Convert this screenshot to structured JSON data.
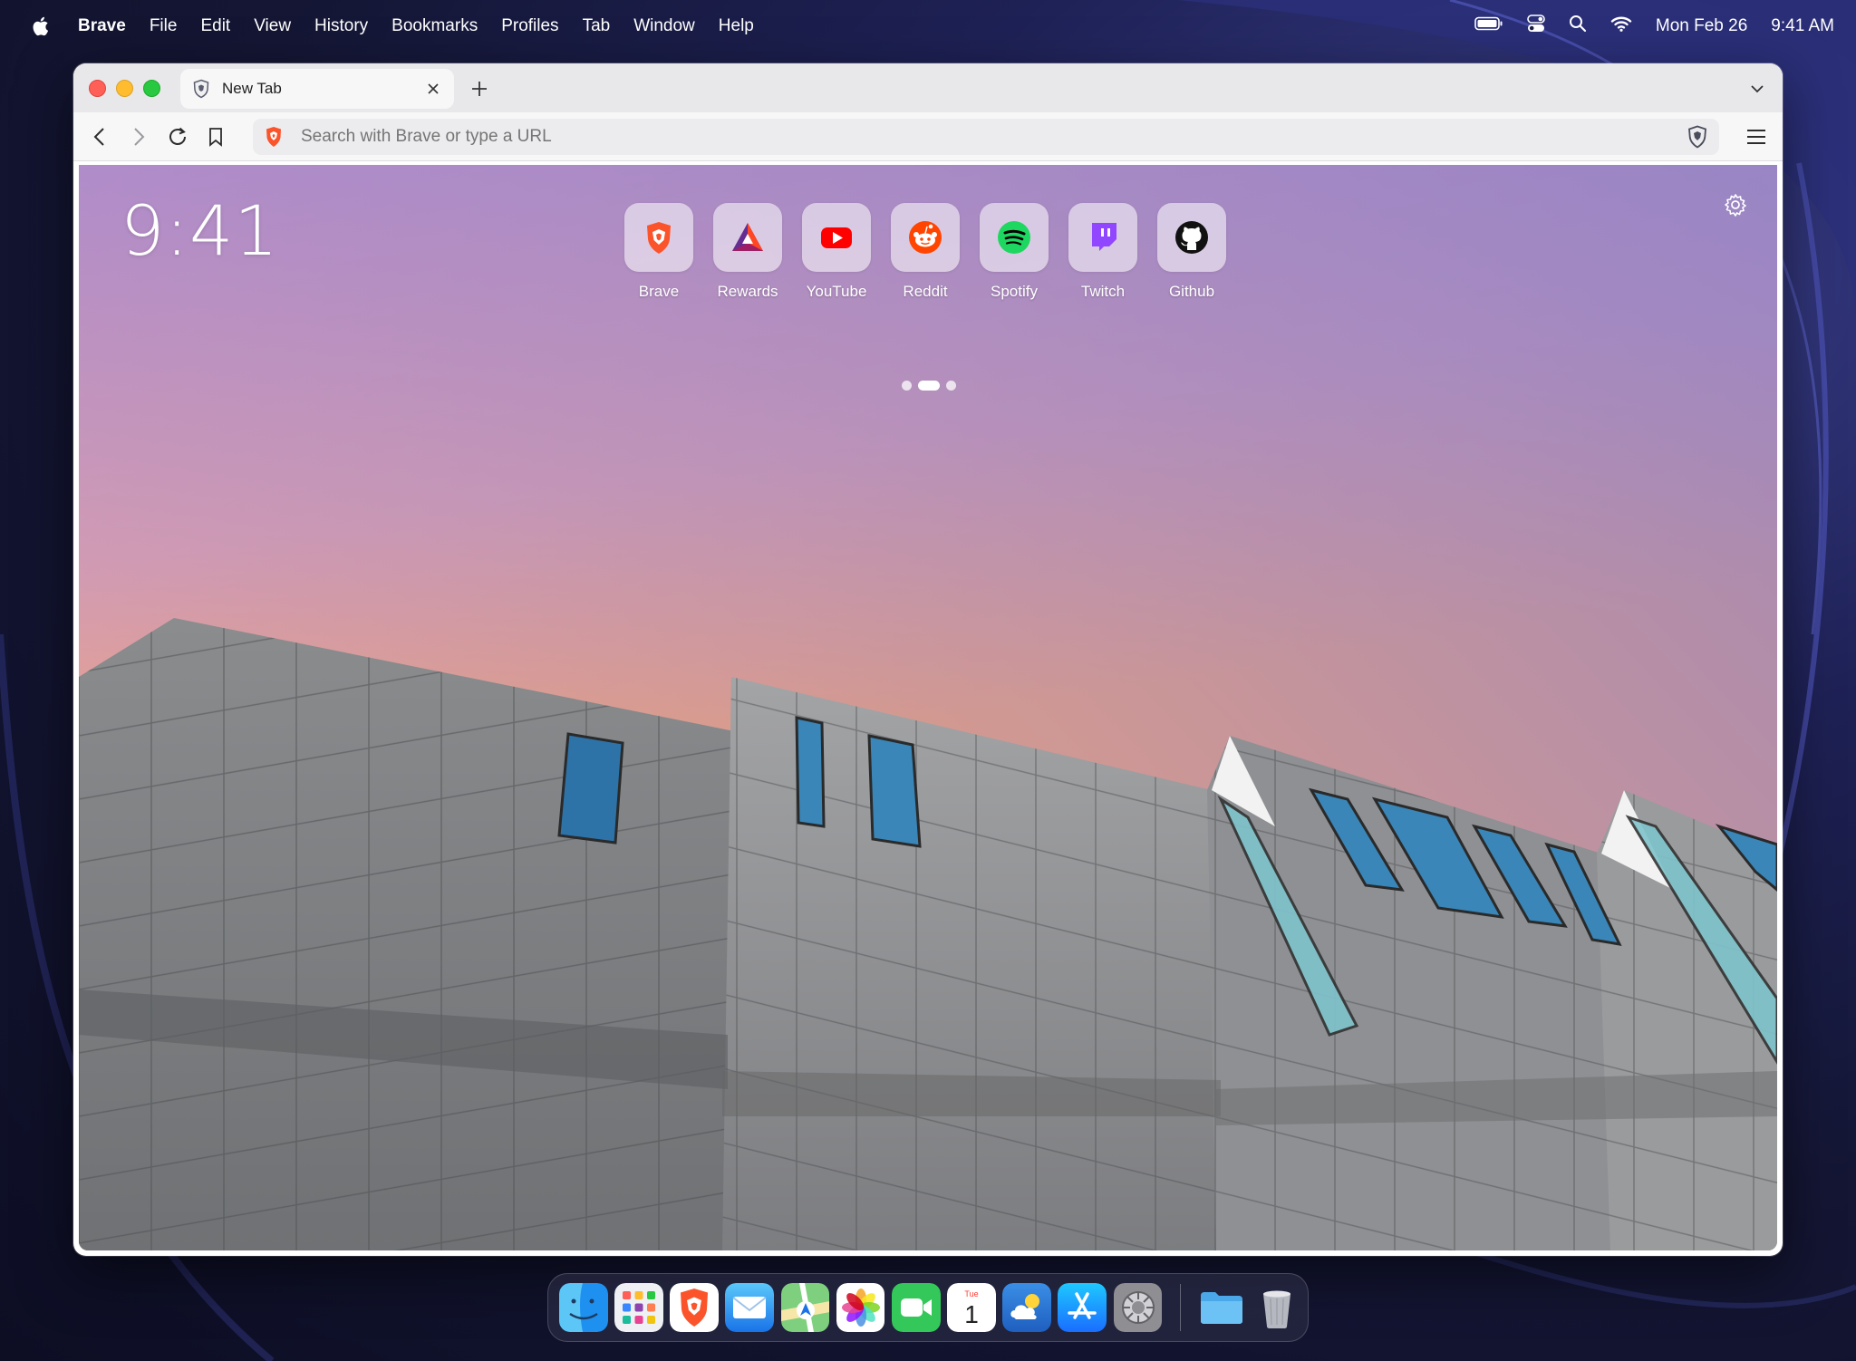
{
  "menubar": {
    "app_name": "Brave",
    "menus": [
      "File",
      "Edit",
      "View",
      "History",
      "Bookmarks",
      "Profiles",
      "Tab",
      "Window",
      "Help"
    ],
    "date": "Mon Feb 26",
    "time": "9:41 AM"
  },
  "tab": {
    "title": "New Tab"
  },
  "urlbar": {
    "placeholder": "Search with Brave or type a URL"
  },
  "newtab": {
    "clock": "9:41",
    "top_sites": [
      {
        "label": "Brave",
        "icon": "brave-lion-icon"
      },
      {
        "label": "Rewards",
        "icon": "bat-triangle-icon"
      },
      {
        "label": "YouTube",
        "icon": "youtube-icon"
      },
      {
        "label": "Reddit",
        "icon": "reddit-icon"
      },
      {
        "label": "Spotify",
        "icon": "spotify-icon"
      },
      {
        "label": "Twitch",
        "icon": "twitch-icon"
      },
      {
        "label": "Github",
        "icon": "github-icon"
      }
    ],
    "pages": 3,
    "active_page": 1
  },
  "dock": {
    "apps": [
      "finder-icon",
      "launchpad-icon",
      "brave-icon",
      "mail-icon",
      "maps-icon",
      "photos-icon",
      "facetime-icon",
      "calendar-icon",
      "weather-icon",
      "app-store-icon",
      "system-settings-icon",
      "folder-icon",
      "trash-icon"
    ],
    "calendar": {
      "month": "Tue",
      "day": "1"
    }
  },
  "colors": {
    "sky_top": "#b98fca",
    "sky_mid": "#d79db1",
    "sky_horizon": "#f4a576",
    "brave_orange": "#fb542b",
    "wall_dark": "#0d0e24"
  }
}
